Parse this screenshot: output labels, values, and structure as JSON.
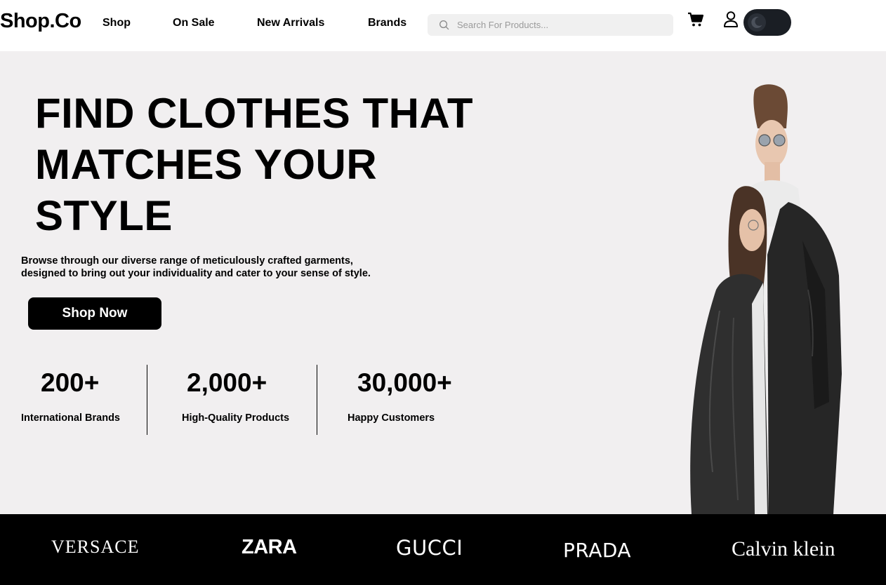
{
  "header": {
    "logo": "Shop.Co",
    "nav": [
      {
        "label": "Shop"
      },
      {
        "label": "On Sale"
      },
      {
        "label": "New Arrivals"
      },
      {
        "label": "Brands"
      }
    ],
    "search": {
      "placeholder": "Search For Products...",
      "value": ""
    },
    "icons": {
      "search": "search-icon",
      "cart": "cart-icon",
      "user": "user-icon",
      "theme": "moon-icon"
    },
    "theme_toggle": {
      "state": "dark"
    }
  },
  "hero": {
    "title_lines": [
      "FIND CLOTHES THAT",
      "MATCHES YOUR",
      "STYLE"
    ],
    "subtitle_lines": [
      "Browse through our diverse range of meticulously crafted garments,",
      "designed to bring out your individuality and cater to your sense of style."
    ],
    "cta_label": "Shop Now",
    "stats": [
      {
        "value": "200+",
        "label": "International Brands"
      },
      {
        "value": "2,000+",
        "label": "High-Quality Products"
      },
      {
        "value": "30,000+",
        "label": "Happy Customers"
      }
    ],
    "background_color": "#f1eff0"
  },
  "brands": [
    "VERSACE",
    "ZARA",
    "GUCCI",
    "PRADA",
    "Calvin klein"
  ],
  "colors": {
    "primary": "#000000",
    "surface": "#f0f0f0",
    "toggle": "#1a1e24"
  }
}
